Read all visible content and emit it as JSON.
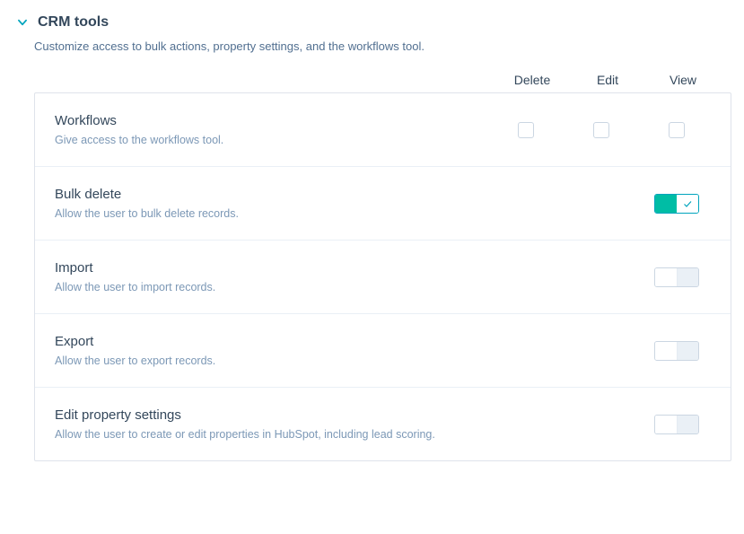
{
  "section": {
    "title": "CRM tools",
    "description": "Customize access to bulk actions, property settings, and the workflows tool."
  },
  "columns": {
    "delete": "Delete",
    "edit": "Edit",
    "view": "View"
  },
  "rows": [
    {
      "key": "workflows",
      "title": "Workflows",
      "desc": "Give access to the workflows tool.",
      "type": "checkboxes",
      "delete": false,
      "edit": false,
      "view": false
    },
    {
      "key": "bulk-delete",
      "title": "Bulk delete",
      "desc": "Allow the user to bulk delete records.",
      "type": "toggle",
      "on": true
    },
    {
      "key": "import",
      "title": "Import",
      "desc": "Allow the user to import records.",
      "type": "toggle",
      "on": false
    },
    {
      "key": "export",
      "title": "Export",
      "desc": "Allow the user to export records.",
      "type": "toggle",
      "on": false
    },
    {
      "key": "edit-property-settings",
      "title": "Edit property settings",
      "desc": "Allow the user to create or edit properties in HubSpot, including lead scoring.",
      "type": "toggle",
      "on": false
    }
  ]
}
